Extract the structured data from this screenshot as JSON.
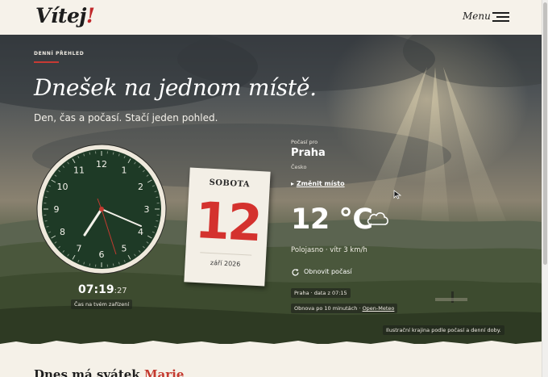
{
  "header": {
    "logo_text": "Vítej",
    "logo_accent": "!",
    "menu_label": "Menu"
  },
  "hero": {
    "eyebrow": "DENNÍ PŘEHLED",
    "title": "Dnešek na jednom místě.",
    "subtitle": "Den, čas a počasí. Stačí jeden pohled."
  },
  "clock": {
    "numerals": [
      "12",
      "1",
      "2",
      "3",
      "4",
      "5",
      "6",
      "7",
      "8",
      "9",
      "10",
      "11"
    ],
    "time_main": "07:19",
    "time_seconds": ":27",
    "note": "Čas na tvém zařízení"
  },
  "calendar": {
    "weekday": "SOBOTA",
    "day": "12",
    "month_year": "září 2026"
  },
  "weather": {
    "label_for": "Počasí pro",
    "city": "Praha",
    "country": "Česko",
    "change_arrow": "▸",
    "change_location": "Změnit místo",
    "temperature": "12 °C",
    "description": "Polojasno · vítr 3 km/h",
    "refresh": "Obnovit počasí",
    "data_info": "Praha · data z 07:15",
    "refresh_info": "Obnova po 10 minutách ·",
    "source_link": "Open-Meteo"
  },
  "illustration_note": "Ilustrační krajina podle počasí a denní doby.",
  "namedays": {
    "prefix": "Dnes má svátek",
    "name": "Marie"
  },
  "colors": {
    "accent": "#c73a34",
    "clock_face": "#1e3a26",
    "calendar_number": "#d4322e"
  }
}
